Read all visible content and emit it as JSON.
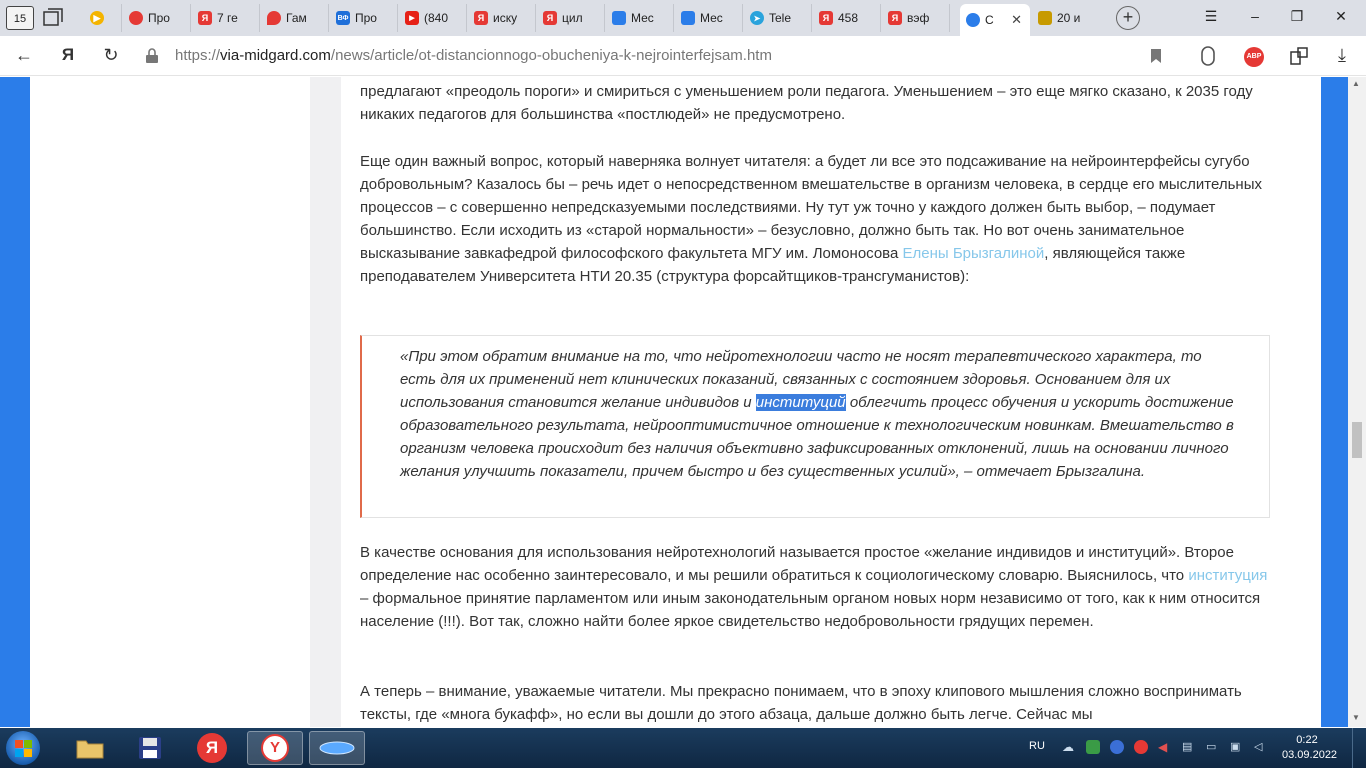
{
  "browser": {
    "home_label": "15",
    "tabs": [
      {
        "label": "",
        "fav_color": "#f4b400",
        "fav_glyph": "▶"
      },
      {
        "label": "Про",
        "fav_color": "#e53935",
        "fav_glyph": "●"
      },
      {
        "label": "7 ге",
        "fav_color": "#e53935",
        "fav_glyph": "Я"
      },
      {
        "label": "Гам",
        "fav_color": "#e53935",
        "fav_glyph": "⬤"
      },
      {
        "label": "Про",
        "fav_color": "#1e6fd9",
        "fav_glyph": "ВФ"
      },
      {
        "label": "(840",
        "fav_color": "#e62117",
        "fav_glyph": "▶"
      },
      {
        "label": "иску",
        "fav_color": "#e53935",
        "fav_glyph": "Я"
      },
      {
        "label": "цил",
        "fav_color": "#e53935",
        "fav_glyph": "Я"
      },
      {
        "label": "Мес",
        "fav_color": "#2b7de9",
        "fav_glyph": "▪"
      },
      {
        "label": "Мес",
        "fav_color": "#2b7de9",
        "fav_glyph": "▪"
      },
      {
        "label": "Tele",
        "fav_color": "#2aa3dc",
        "fav_glyph": "➤"
      },
      {
        "label": "458",
        "fav_color": "#e53935",
        "fav_glyph": "Я"
      },
      {
        "label": "вэф",
        "fav_color": "#e53935",
        "fav_glyph": "Я"
      },
      {
        "label": "С",
        "fav_color": "#2b7de9",
        "fav_glyph": "◉",
        "active": true
      },
      {
        "label": "20 и",
        "fav_color": "#c79a00",
        "fav_glyph": "■"
      }
    ],
    "url_scheme": "https://",
    "url_host": "via-midgard.com",
    "url_path": "/news/article/ot-distancionnogo-obucheniya-k-nejrointerfejsam.htm",
    "abp_label": "ABP"
  },
  "article": {
    "p1": "предлагают «преодоль пороги» и смириться с уменьшением роли педагога. Уменьшением – это еще мягко сказано, к 2035 году никаких педагогов для большинства «постлюдей» не предусмотрено.",
    "p2_a": "Еще один важный вопрос, который наверняка волнует читателя: а будет ли все это подсаживание на нейроинтерфейсы сугубо добровольным? Казалось бы – речь идет о непосредственном вмешательстве в организм человека, в сердце его мыслительных процессов – с совершенно непредсказуемыми последствиями. Ну тут уж точно у каждого должен быть выбор, – подумает большинство. Если исходить из «старой нормальности» – безусловно, должно быть так. Но вот очень занимательное высказывание завкафедрой философского факультета МГУ им. Ломоносова ",
    "p2_link": "Елены Брызгалиной",
    "p2_b": ", являющейся также преподавателем Университета НТИ 20.35 (структура форсайтщиков-трансгуманистов):",
    "quote_a": "«При этом обратим внимание на то, что нейротехнологии часто не носят терапевтического характера, то есть для их применений нет клинических показаний, связанных с состоянием здоровья. Основанием для их использования становится желание индивидов и ",
    "quote_hl": "институций",
    "quote_b": " облегчить процесс обучения и ускорить достижение образовательного результата, нейрооптимистичное отношение к технологическим новинкам. Вмешательство в организм человека происходит без наличия объективно зафиксированных отклонений, лишь на основании личного желания улучшить показатели, причем быстро и без существенных усилий», – отмечает Брызгалина.",
    "p3_a": "В качестве основания для использования нейротехнологий называется простое «желание индивидов и институций». Второе определение нас особенно заинтересовало, и мы решили обратиться к социологическому словарю. Выяснилось, что ",
    "p3_link": "институция",
    "p3_b": " – формальное принятие парламентом или иным законодательным органом новых норм независимо от того, как к ним относится население (!!!). Вот так, сложно найти более яркое свидетельство недобровольности грядущих перемен.",
    "p4": "А теперь – внимание, уважаемые читатели. Мы прекрасно понимаем, что в эпоху клипового мышления сложно воспринимать тексты, где «многа букафф», но если вы дошли до этого абзаца, дальше должно быть легче. Сейчас мы"
  },
  "taskbar": {
    "lang": "RU",
    "time": "0:22",
    "date": "03.09.2022"
  },
  "colors": {
    "accent_blue": "#2b7de9",
    "quote_border": "#e06a4a",
    "link": "#86c7ea",
    "highlight": "#3b7ddd"
  }
}
